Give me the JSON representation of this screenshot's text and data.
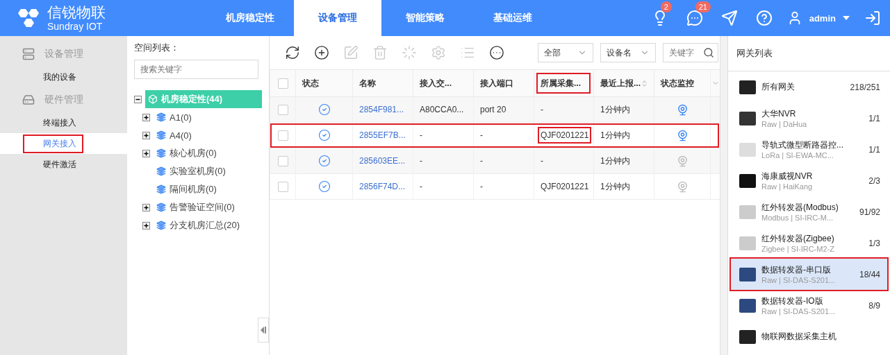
{
  "header": {
    "logo_title": "信锐物联",
    "logo_subtitle": "Sundray IOT",
    "tabs": [
      {
        "label": "机房稳定性",
        "selected": false
      },
      {
        "label": "设备管理",
        "selected": true
      },
      {
        "label": "智能策略",
        "selected": false
      },
      {
        "label": "基础运维",
        "selected": false
      }
    ],
    "actions": [
      {
        "kind": "bulb",
        "badge": "2"
      },
      {
        "kind": "message",
        "badge": "21"
      },
      {
        "kind": "send"
      },
      {
        "kind": "help"
      }
    ],
    "user": "admin"
  },
  "sidebar": {
    "groups": [
      {
        "kind": "devices",
        "label": "设备管理",
        "items": [
          {
            "label": "我的设备",
            "selected": false,
            "highlighted": false
          }
        ]
      },
      {
        "kind": "hardware",
        "label": "硬件管理",
        "items": [
          {
            "label": "终端接入",
            "selected": false,
            "highlighted": false
          },
          {
            "label": "网关接入",
            "selected": true,
            "highlighted": true
          },
          {
            "label": "硬件激活",
            "selected": false,
            "highlighted": false
          }
        ]
      }
    ]
  },
  "space_panel": {
    "title": "空间列表：",
    "search": {
      "placeholder": "搜索关键字"
    },
    "tree": [
      {
        "label": "机房稳定性(44)",
        "kind": "expanded",
        "selected": true,
        "children": [
          {
            "label": "A1(0)",
            "kind": "collapsed",
            "selected": false
          },
          {
            "label": "A4(0)",
            "kind": "collapsed",
            "selected": false
          },
          {
            "label": "核心机房(0)",
            "kind": "collapsed",
            "selected": false
          },
          {
            "label": "实验室机房(0)",
            "kind": "leaf",
            "selected": false
          },
          {
            "label": "隔间机房(0)",
            "kind": "leaf",
            "selected": false
          },
          {
            "label": "告警验证空间(0)",
            "kind": "collapsed",
            "selected": false
          },
          {
            "label": "分支机房汇总(20)",
            "kind": "collapsed",
            "selected": false
          }
        ]
      }
    ]
  },
  "toolbar": {
    "tools": [
      {
        "kind": "refresh",
        "disabled": false
      },
      {
        "kind": "add",
        "disabled": false
      },
      {
        "kind": "edit",
        "disabled": true
      },
      {
        "kind": "delete",
        "disabled": true
      },
      {
        "kind": "dial",
        "disabled": true
      },
      {
        "kind": "settings",
        "disabled": true
      },
      {
        "kind": "list",
        "disabled": true
      },
      {
        "kind": "more",
        "disabled": false
      }
    ],
    "filter_1": "全部",
    "filter_2": "设备名",
    "search": {
      "placeholder": "关键字"
    }
  },
  "table": {
    "select_all_checked": false,
    "columns": [
      {
        "label": "状态",
        "sortable": false,
        "highlighted": false
      },
      {
        "label": "名称",
        "sortable": false,
        "highlighted": false
      },
      {
        "label": "接入交...",
        "sortable": false,
        "highlighted": false
      },
      {
        "label": "接入端口",
        "sortable": false,
        "highlighted": false
      },
      {
        "label": "所属采集...",
        "sortable": false,
        "highlighted": true
      },
      {
        "label": "最近上报...",
        "sortable": true,
        "highlighted": false
      },
      {
        "label": "状态监控",
        "sortable": false,
        "highlighted": false
      }
    ],
    "rows": [
      {
        "checked": false,
        "highlighted": false,
        "name": "2854F981...",
        "switch": "A80CCA0...",
        "port": "port 20",
        "collector": "-",
        "collector_highlighted": false,
        "last_report": "1分钟内",
        "monitoring": true
      },
      {
        "checked": false,
        "highlighted": true,
        "name": "2855EF7B...",
        "switch": "-",
        "port": "-",
        "collector": "QJF0201221",
        "collector_highlighted": true,
        "last_report": "1分钟内",
        "monitoring": true
      },
      {
        "checked": false,
        "highlighted": false,
        "name": "285603EE...",
        "switch": "-",
        "port": "-",
        "collector": "-",
        "collector_highlighted": false,
        "last_report": "1分钟内",
        "monitoring": false
      },
      {
        "checked": false,
        "highlighted": false,
        "name": "2856F74D...",
        "switch": "-",
        "port": "-",
        "collector": "QJF0201221",
        "collector_highlighted": false,
        "last_report": "1分钟内",
        "monitoring": false
      }
    ]
  },
  "gateway_panel": {
    "title": "网关列表",
    "items": [
      {
        "name": "所有网关",
        "count": "218/251",
        "selected": false,
        "highlighted": false
      },
      {
        "name": "大华NVR",
        "detail": "Raw | DaHua",
        "count": "1/1",
        "selected": false,
        "highlighted": false
      },
      {
        "name": "导轨式微型断路器控...",
        "detail": "LoRa | SI-EWA-MC...",
        "count": "1/1",
        "selected": false,
        "highlighted": false
      },
      {
        "name": "海康威视NVR",
        "detail": "Raw | HaiKang",
        "count": "2/3",
        "selected": false,
        "highlighted": false
      },
      {
        "name": "红外转发器(Modbus)",
        "detail": "Modbus | SI-IRC-M...",
        "count": "91/92",
        "selected": false,
        "highlighted": false
      },
      {
        "name": "红外转发器(Zigbee)",
        "detail": "Zigbee | SI-IRC-M2-Z",
        "count": "1/3",
        "selected": false,
        "highlighted": false
      },
      {
        "name": "数据转发器-串口版",
        "detail": "Raw | SI-DAS-S201...",
        "count": "18/44",
        "selected": true,
        "highlighted": true
      },
      {
        "name": "数据转发器-IO版",
        "detail": "Raw | SI-DAS-S201...",
        "count": "8/9",
        "selected": false,
        "highlighted": false
      },
      {
        "name": "物联网数据采集主机",
        "selected": false,
        "highlighted": false
      }
    ]
  }
}
